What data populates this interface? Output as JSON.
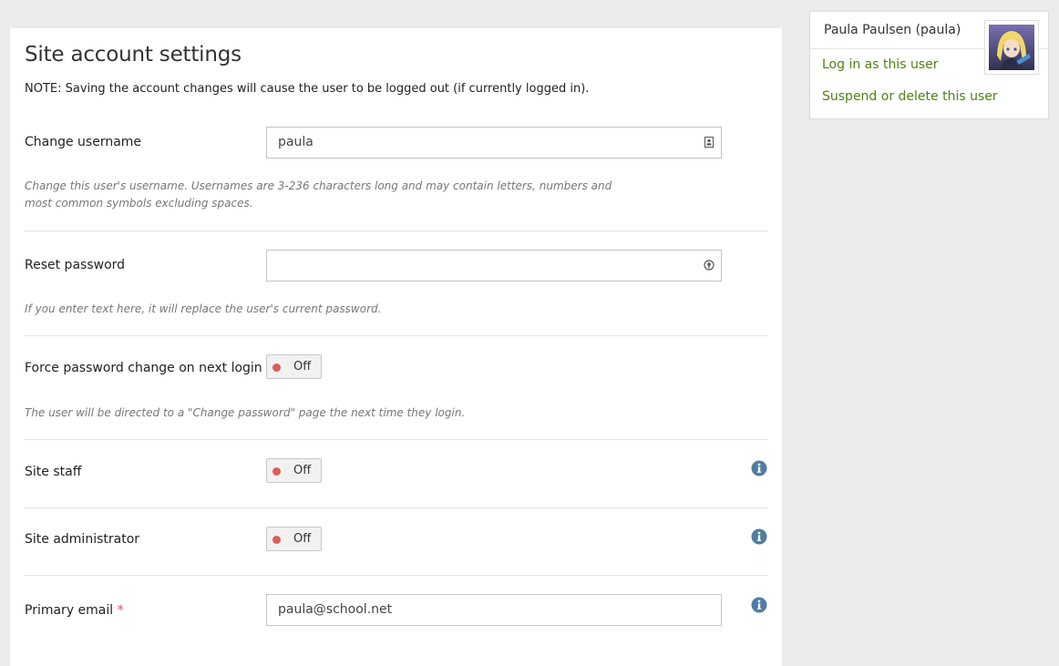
{
  "main": {
    "title": "Site account settings",
    "note": "NOTE: Saving the account changes will cause the user to be logged out (if currently logged in).",
    "username": {
      "label": "Change username",
      "value": "paula",
      "icon": "contact-card-icon",
      "description": "Change this user's username. Usernames are 3-236 characters long and may contain letters, numbers and most common symbols excluding spaces."
    },
    "password": {
      "label": "Reset password",
      "value": "",
      "icon": "password-key-icon",
      "description": "If you enter text here, it will replace the user's current password."
    },
    "force_change": {
      "label": "Force password change on next login",
      "switch_text": "Off",
      "description": "The user will be directed to a \"Change password\" page the next time they login."
    },
    "site_staff": {
      "label": "Site staff",
      "switch_text": "Off",
      "icon": "info-icon"
    },
    "site_admin": {
      "label": "Site administrator",
      "switch_text": "Off",
      "icon": "info-icon"
    },
    "primary_email": {
      "label": "Primary email",
      "required_mark": "*",
      "value": "paula@school.net",
      "icon": "info-icon"
    }
  },
  "side": {
    "user_name": "Paula Paulsen (paula)",
    "links": [
      "Log in as this user",
      "Suspend or delete this user"
    ]
  },
  "colors": {
    "link": "#4e8213",
    "switch_off_dot": "#db5c5c",
    "info_icon": "#4f7da2",
    "required": "#d9534f",
    "page_background": "#ebebeb"
  }
}
